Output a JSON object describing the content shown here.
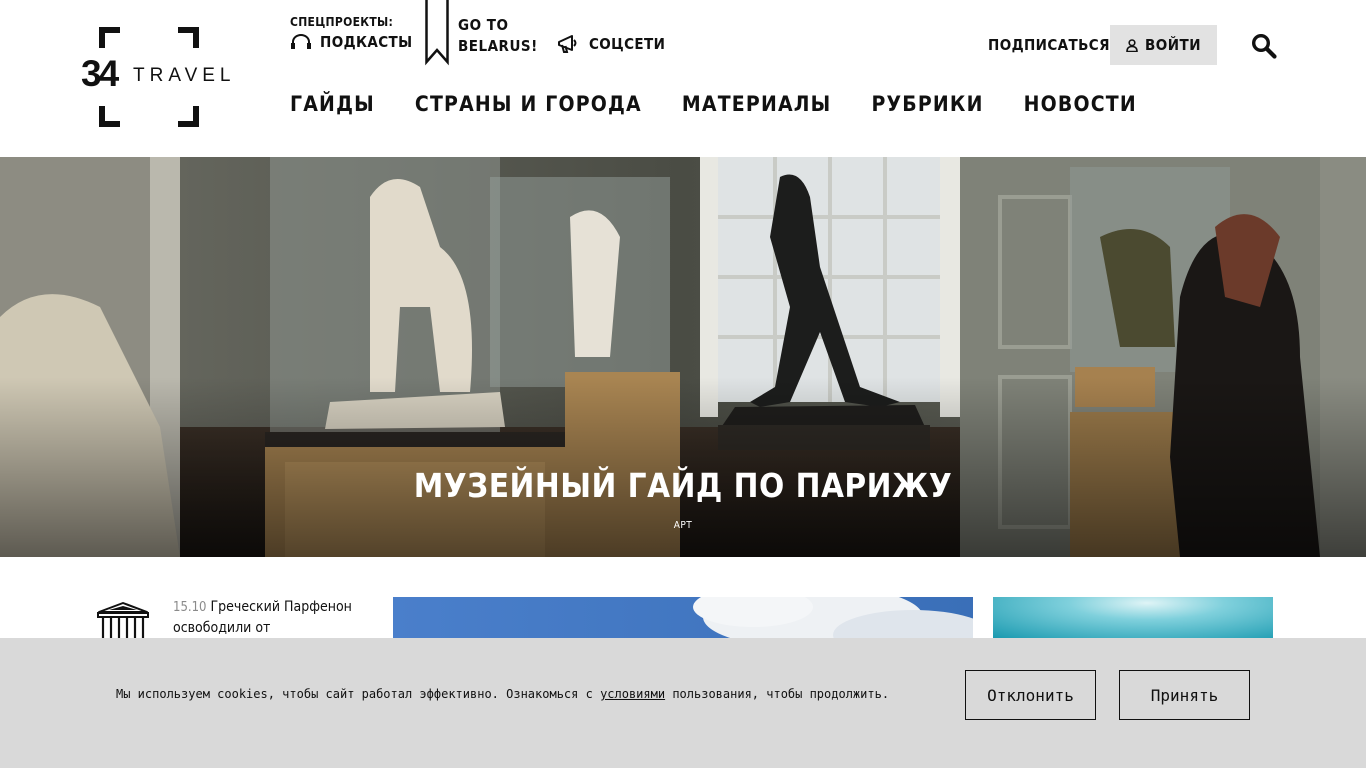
{
  "logo": {
    "number": "34",
    "word": "TRAVEL"
  },
  "header": {
    "special_label": "СПЕЦПРОЕКТЫ:",
    "podcasts": "ПОДКАСТЫ",
    "goto_line1": "GO TO",
    "goto_line2": "BELARUS!",
    "social": "СОЦСЕТИ",
    "subscribe": "ПОДПИСАТЬСЯ",
    "login": "ВОЙТИ"
  },
  "nav": {
    "items": [
      {
        "label": "ГАЙДЫ"
      },
      {
        "label": "СТРАНЫ И ГОРОДА"
      },
      {
        "label": "МАТЕРИАЛЫ"
      },
      {
        "label": "РУБРИКИ"
      },
      {
        "label": "НОВОСТИ"
      }
    ]
  },
  "hero": {
    "title": "МУЗЕЙНЫЙ ГАЙД ПО ПАРИЖУ",
    "tag": "АРТ"
  },
  "news": {
    "date": "15.10",
    "text": "Греческий Парфенон освободили от строительных"
  },
  "cookie": {
    "text_before": "Мы используем cookies, чтобы сайт работал эффективно. Ознакомься с ",
    "link": "условиями",
    "text_after": " пользования, чтобы продолжить.",
    "decline": "Отклонить",
    "accept": "Принять"
  },
  "colors": {
    "text": "#111111",
    "login_bg": "#e2e2e2",
    "cookie_bg": "#d9d9d9",
    "date_gray": "#8a8a8a"
  },
  "icons": {
    "podcast": "headphones-icon",
    "goto": "bookmark-icon",
    "social": "megaphone-icon",
    "login": "user-icon",
    "search": "search-icon",
    "news": "parthenon-icon"
  }
}
